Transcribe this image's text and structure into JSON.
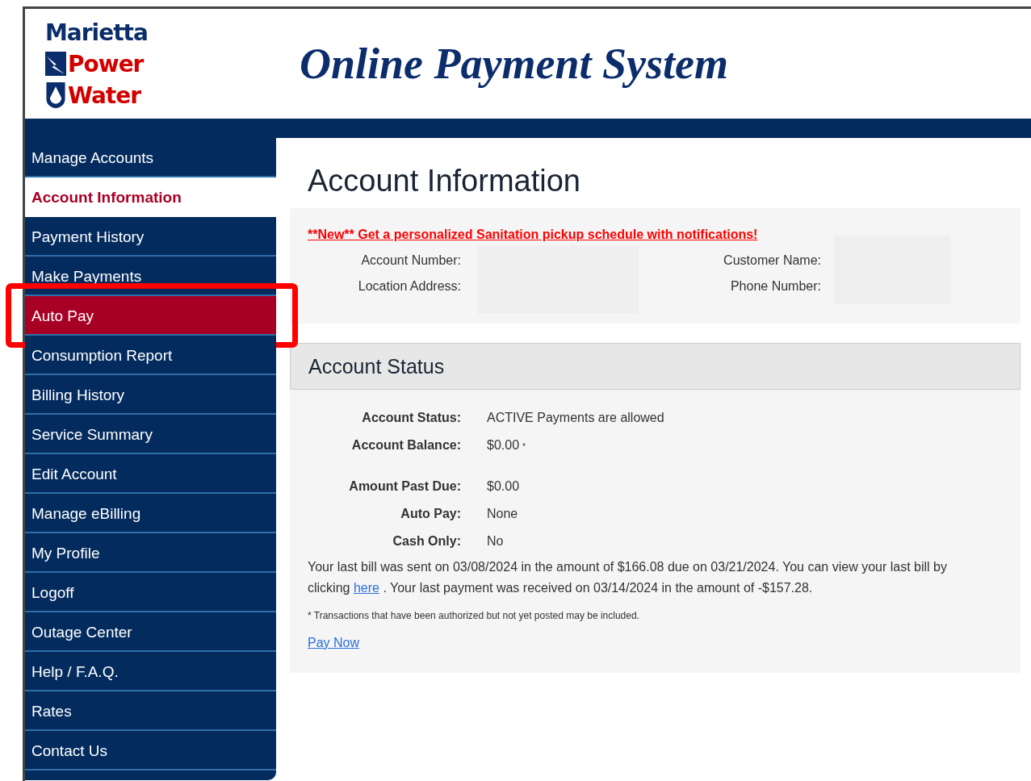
{
  "logo": {
    "lines": [
      "Marietta",
      "Power",
      "Water"
    ]
  },
  "header": {
    "title": "Online Payment System"
  },
  "sidebar": {
    "items": [
      {
        "label": "Manage Accounts",
        "selected": false,
        "highlighted": false
      },
      {
        "label": "Account Information",
        "selected": true,
        "highlighted": false
      },
      {
        "label": "Payment History",
        "selected": false,
        "highlighted": false
      },
      {
        "label": "Make Payments",
        "selected": false,
        "highlighted": false
      },
      {
        "label": "Auto Pay",
        "selected": false,
        "highlighted": true
      },
      {
        "label": "Consumption Report",
        "selected": false,
        "highlighted": false
      },
      {
        "label": "Billing History",
        "selected": false,
        "highlighted": false
      },
      {
        "label": "Service Summary",
        "selected": false,
        "highlighted": false
      },
      {
        "label": "Edit Account",
        "selected": false,
        "highlighted": false
      },
      {
        "label": "Manage eBilling",
        "selected": false,
        "highlighted": false
      },
      {
        "label": "My Profile",
        "selected": false,
        "highlighted": false
      },
      {
        "label": "Logoff",
        "selected": false,
        "highlighted": false
      },
      {
        "label": "Outage Center",
        "selected": false,
        "highlighted": false
      },
      {
        "label": "Help / F.A.Q.",
        "selected": false,
        "highlighted": false
      },
      {
        "label": "Rates",
        "selected": false,
        "highlighted": false
      },
      {
        "label": "Contact Us",
        "selected": false,
        "highlighted": false
      }
    ]
  },
  "page_title": "Account Information",
  "notice_link": "**New** Get a personalized Sanitation pickup schedule with notifications!",
  "account_fields": {
    "left": [
      "Account Number:",
      "Location Address:"
    ],
    "right": [
      "Customer Name:",
      "Phone Number:"
    ]
  },
  "status": {
    "heading": "Account Status",
    "rows": [
      {
        "label": "Account Status:",
        "value": "ACTIVE Payments are allowed"
      },
      {
        "label": "Account Balance:",
        "value": "$0.00",
        "note": "*"
      },
      {
        "label": "Amount Past Due:",
        "value": "$0.00",
        "gap_before": true
      },
      {
        "label": "Auto Pay:",
        "value": "None"
      },
      {
        "label": "Cash Only:",
        "value": "No"
      }
    ],
    "summary_before": "Your last bill was sent on 03/08/2024 in the amount of $166.08 due on 03/21/2024. You can view your last bill by clicking",
    "summary_link": "here",
    "summary_after": ". Your last payment was received on 03/14/2024 in the amount of -$157.28.",
    "footnote": "* Transactions that have been authorized but not yet posted may be included.",
    "pay_link": "Pay Now"
  }
}
